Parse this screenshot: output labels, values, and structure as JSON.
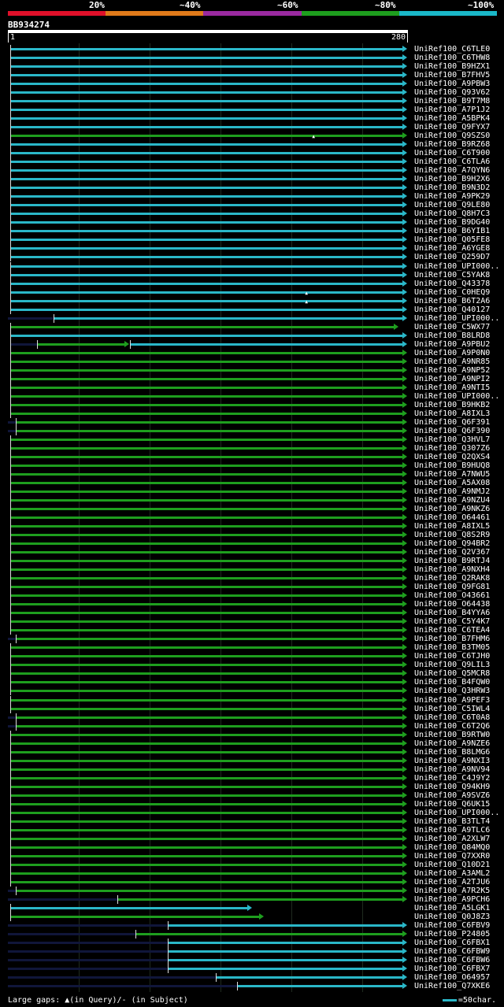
{
  "header": {
    "pct_labels": [
      "20%",
      "~40%",
      "~60%",
      "~80%",
      "~100%"
    ],
    "colors": [
      "#e0102a",
      "#e07a1a",
      "#9a2aa0",
      "#1e9e1e",
      "#1ab8c8"
    ]
  },
  "query": {
    "id": "BB934274",
    "start": "1",
    "end": "280"
  },
  "colors": {
    "cyan": "#2ab7c8",
    "green": "#1e9e1e",
    "purple": "#9a2aa0",
    "orange": "#e07a1a",
    "red": "#e0102a",
    "navy": "#10163a"
  },
  "hits": [
    {
      "label": "UniRef100_C6TLE0",
      "s": 1,
      "e": 280,
      "c": "cyan",
      "a": 1
    },
    {
      "label": "UniRef100_C6THW8",
      "s": 1,
      "e": 280,
      "c": "cyan",
      "a": 1
    },
    {
      "label": "UniRef100_B9HZX1",
      "s": 1,
      "e": 280,
      "c": "cyan",
      "a": 1
    },
    {
      "label": "UniRef100_B7FHV5",
      "s": 1,
      "e": 280,
      "c": "cyan",
      "a": 1
    },
    {
      "label": "UniRef100_A9PBW3",
      "s": 1,
      "e": 280,
      "c": "cyan",
      "a": 1
    },
    {
      "label": "UniRef100_Q93V62",
      "s": 1,
      "e": 280,
      "c": "cyan",
      "a": 1
    },
    {
      "label": "UniRef100_B9T7M8",
      "s": 1,
      "e": 280,
      "c": "cyan",
      "a": 1
    },
    {
      "label": "UniRef100_A7P1J2",
      "s": 1,
      "e": 280,
      "c": "cyan",
      "a": 1
    },
    {
      "label": "UniRef100_A5BPK4",
      "s": 1,
      "e": 280,
      "c": "cyan",
      "a": 1
    },
    {
      "label": "UniRef100_Q9FYX7",
      "s": 1,
      "e": 280,
      "c": "cyan",
      "a": 1
    },
    {
      "label": "UniRef100_Q9SZS0",
      "s": 1,
      "e": 280,
      "c": "green",
      "a": 1,
      "g": 217
    },
    {
      "label": "UniRef100_B9RZ68",
      "s": 1,
      "e": 280,
      "c": "cyan",
      "a": 1
    },
    {
      "label": "UniRef100_C6T900",
      "s": 1,
      "e": 280,
      "c": "cyan",
      "a": 1
    },
    {
      "label": "UniRef100_C6TLA6",
      "s": 1,
      "e": 280,
      "c": "cyan",
      "a": 1
    },
    {
      "label": "UniRef100_A7QYN6",
      "s": 1,
      "e": 280,
      "c": "cyan",
      "a": 1
    },
    {
      "label": "UniRef100_B9H2X6",
      "s": 1,
      "e": 280,
      "c": "cyan",
      "a": 1
    },
    {
      "label": "UniRef100_B9N3D2",
      "s": 1,
      "e": 280,
      "c": "cyan",
      "a": 1
    },
    {
      "label": "UniRef100_A9PK29",
      "s": 1,
      "e": 280,
      "c": "cyan",
      "a": 1
    },
    {
      "label": "UniRef100_Q9LE80",
      "s": 1,
      "e": 280,
      "c": "cyan",
      "a": 1
    },
    {
      "label": "UniRef100_Q8H7C3",
      "s": 1,
      "e": 280,
      "c": "cyan",
      "a": 1
    },
    {
      "label": "UniRef100_B9DG40",
      "s": 1,
      "e": 280,
      "c": "cyan",
      "a": 1
    },
    {
      "label": "UniRef100_B6YIB1",
      "s": 1,
      "e": 280,
      "c": "cyan",
      "a": 1
    },
    {
      "label": "UniRef100_Q05FE8",
      "s": 1,
      "e": 280,
      "c": "cyan",
      "a": 1
    },
    {
      "label": "UniRef100_A6YGE8",
      "s": 1,
      "e": 280,
      "c": "cyan",
      "a": 1
    },
    {
      "label": "UniRef100_Q259D7",
      "s": 1,
      "e": 280,
      "c": "cyan",
      "a": 1
    },
    {
      "label": "UniRef100_UPI000..",
      "s": 1,
      "e": 280,
      "c": "cyan",
      "a": 1
    },
    {
      "label": "UniRef100_C5YAK8",
      "s": 1,
      "e": 280,
      "c": "cyan",
      "a": 1
    },
    {
      "label": "UniRef100_Q43378",
      "s": 1,
      "e": 280,
      "c": "cyan",
      "a": 1
    },
    {
      "label": "UniRef100_C0HEQ9",
      "s": 1,
      "e": 280,
      "c": "cyan",
      "a": 1,
      "g": 212
    },
    {
      "label": "UniRef100_B6T2A6",
      "s": 1,
      "e": 280,
      "c": "cyan",
      "a": 1,
      "g": 212
    },
    {
      "label": "UniRef100_Q40127",
      "s": 1,
      "e": 280,
      "c": "cyan",
      "a": 1
    },
    {
      "label": "UniRef100_UPI000..",
      "s": 32,
      "e": 280,
      "c": "cyan",
      "a": 1,
      "t": 1
    },
    {
      "label": "UniRef100_C5WX77",
      "s": 1,
      "e": 274,
      "c": "green",
      "a": 1
    },
    {
      "label": "UniRef100_B8LRD8",
      "s": 1,
      "e": 280,
      "c": "cyan",
      "a": 1
    },
    {
      "label": "UniRef100_A9PBU2",
      "s": 1,
      "e": 280,
      "c": "mixed",
      "a": 1
    },
    {
      "label": "UniRef100_A9P0N0",
      "s": 1,
      "e": 280,
      "c": "green",
      "a": 1
    },
    {
      "label": "UniRef100_A9NR85",
      "s": 1,
      "e": 280,
      "c": "green",
      "a": 1
    },
    {
      "label": "UniRef100_A9NP52",
      "s": 1,
      "e": 280,
      "c": "green",
      "a": 1
    },
    {
      "label": "UniRef100_A9NPI2",
      "s": 1,
      "e": 280,
      "c": "green",
      "a": 1
    },
    {
      "label": "UniRef100_A9NTI5",
      "s": 1,
      "e": 280,
      "c": "green",
      "a": 1
    },
    {
      "label": "UniRef100_UPI000..",
      "s": 1,
      "e": 280,
      "c": "green",
      "a": 1
    },
    {
      "label": "UniRef100_B9HKB2",
      "s": 1,
      "e": 280,
      "c": "green",
      "a": 1
    },
    {
      "label": "UniRef100_A8IXL3",
      "s": 1,
      "e": 280,
      "c": "green",
      "a": 1
    },
    {
      "label": "UniRef100_Q6F391",
      "s": 5,
      "e": 280,
      "c": "green",
      "a": 1,
      "t": 1
    },
    {
      "label": "UniRef100_Q6F390",
      "s": 5,
      "e": 280,
      "c": "green",
      "a": 1,
      "t": 1
    },
    {
      "label": "UniRef100_Q3HVL7",
      "s": 1,
      "e": 280,
      "c": "green",
      "a": 1
    },
    {
      "label": "UniRef100_Q307Z6",
      "s": 1,
      "e": 280,
      "c": "green",
      "a": 1
    },
    {
      "label": "UniRef100_Q2QXS4",
      "s": 1,
      "e": 280,
      "c": "green",
      "a": 1
    },
    {
      "label": "UniRef100_B9HUQ8",
      "s": 1,
      "e": 280,
      "c": "green",
      "a": 1
    },
    {
      "label": "UniRef100_A7NWU5",
      "s": 1,
      "e": 280,
      "c": "green",
      "a": 1
    },
    {
      "label": "UniRef100_A5AX08",
      "s": 1,
      "e": 280,
      "c": "green",
      "a": 1
    },
    {
      "label": "UniRef100_A9NMJ2",
      "s": 1,
      "e": 280,
      "c": "green",
      "a": 1
    },
    {
      "label": "UniRef100_A9NZU4",
      "s": 1,
      "e": 280,
      "c": "green",
      "a": 1
    },
    {
      "label": "UniRef100_A9NKZ6",
      "s": 1,
      "e": 280,
      "c": "green",
      "a": 1
    },
    {
      "label": "UniRef100_O64461",
      "s": 1,
      "e": 280,
      "c": "green",
      "a": 1
    },
    {
      "label": "UniRef100_A8IXL5",
      "s": 1,
      "e": 280,
      "c": "green",
      "a": 1
    },
    {
      "label": "UniRef100_Q8S2R9",
      "s": 1,
      "e": 280,
      "c": "green",
      "a": 1
    },
    {
      "label": "UniRef100_Q94BR2",
      "s": 1,
      "e": 280,
      "c": "green",
      "a": 1
    },
    {
      "label": "UniRef100_Q2V367",
      "s": 1,
      "e": 280,
      "c": "green",
      "a": 1
    },
    {
      "label": "UniRef100_B9RTJ4",
      "s": 1,
      "e": 280,
      "c": "green",
      "a": 1
    },
    {
      "label": "UniRef100_A9NXH4",
      "s": 1,
      "e": 280,
      "c": "green",
      "a": 1
    },
    {
      "label": "UniRef100_Q2RAK8",
      "s": 1,
      "e": 280,
      "c": "green",
      "a": 1
    },
    {
      "label": "UniRef100_Q9FG81",
      "s": 1,
      "e": 280,
      "c": "green",
      "a": 1
    },
    {
      "label": "UniRef100_O43661",
      "s": 1,
      "e": 280,
      "c": "green",
      "a": 1
    },
    {
      "label": "UniRef100_O64438",
      "s": 1,
      "e": 280,
      "c": "green",
      "a": 1
    },
    {
      "label": "UniRef100_B4YYA6",
      "s": 1,
      "e": 280,
      "c": "green",
      "a": 1
    },
    {
      "label": "UniRef100_C5Y4K7",
      "s": 1,
      "e": 280,
      "c": "green",
      "a": 1
    },
    {
      "label": "UniRef100_C6TEA4",
      "s": 1,
      "e": 280,
      "c": "green",
      "a": 1
    },
    {
      "label": "UniRef100_B7FHM6",
      "s": 5,
      "e": 280,
      "c": "green",
      "a": 1,
      "t": 1
    },
    {
      "label": "UniRef100_B3TM05",
      "s": 1,
      "e": 280,
      "c": "green",
      "a": 1
    },
    {
      "label": "UniRef100_C6TJH0",
      "s": 1,
      "e": 280,
      "c": "green",
      "a": 1
    },
    {
      "label": "UniRef100_Q9LIL3",
      "s": 1,
      "e": 280,
      "c": "green",
      "a": 1
    },
    {
      "label": "UniRef100_Q5MCR8",
      "s": 1,
      "e": 280,
      "c": "green",
      "a": 1
    },
    {
      "label": "UniRef100_B4FQW0",
      "s": 1,
      "e": 280,
      "c": "green",
      "a": 1
    },
    {
      "label": "UniRef100_Q3HRW3",
      "s": 1,
      "e": 280,
      "c": "green",
      "a": 1
    },
    {
      "label": "UniRef100_A9PEF3",
      "s": 1,
      "e": 280,
      "c": "green",
      "a": 1
    },
    {
      "label": "UniRef100_C5IWL4",
      "s": 1,
      "e": 280,
      "c": "green",
      "a": 1
    },
    {
      "label": "UniRef100_C6T0A8",
      "s": 5,
      "e": 280,
      "c": "green",
      "a": 1,
      "t": 1
    },
    {
      "label": "UniRef100_C6T2Q6",
      "s": 5,
      "e": 280,
      "c": "green",
      "a": 1,
      "t": 1
    },
    {
      "label": "UniRef100_B9RTW0",
      "s": 1,
      "e": 280,
      "c": "green",
      "a": 1
    },
    {
      "label": "UniRef100_A9NZE6",
      "s": 1,
      "e": 280,
      "c": "green",
      "a": 1
    },
    {
      "label": "UniRef100_B8LMG6",
      "s": 1,
      "e": 280,
      "c": "green",
      "a": 1
    },
    {
      "label": "UniRef100_A9NXI3",
      "s": 1,
      "e": 280,
      "c": "green",
      "a": 1
    },
    {
      "label": "UniRef100_A9NV94",
      "s": 1,
      "e": 280,
      "c": "green",
      "a": 1
    },
    {
      "label": "UniRef100_C4J9Y2",
      "s": 1,
      "e": 280,
      "c": "green",
      "a": 1
    },
    {
      "label": "UniRef100_Q94KH9",
      "s": 1,
      "e": 280,
      "c": "green",
      "a": 1
    },
    {
      "label": "UniRef100_A9SVZ6",
      "s": 1,
      "e": 280,
      "c": "green",
      "a": 1
    },
    {
      "label": "UniRef100_Q6UK15",
      "s": 1,
      "e": 280,
      "c": "green",
      "a": 1
    },
    {
      "label": "UniRef100_UPI000..",
      "s": 1,
      "e": 280,
      "c": "green",
      "a": 1
    },
    {
      "label": "UniRef100_B3TLT4",
      "s": 1,
      "e": 280,
      "c": "green",
      "a": 1
    },
    {
      "label": "UniRef100_A9TLC6",
      "s": 1,
      "e": 280,
      "c": "green",
      "a": 1
    },
    {
      "label": "UniRef100_A2XLW7",
      "s": 1,
      "e": 280,
      "c": "green",
      "a": 1
    },
    {
      "label": "UniRef100_Q84MQ0",
      "s": 1,
      "e": 280,
      "c": "green",
      "a": 1
    },
    {
      "label": "UniRef100_Q7XXR0",
      "s": 1,
      "e": 280,
      "c": "green",
      "a": 1
    },
    {
      "label": "UniRef100_Q10D21",
      "s": 1,
      "e": 280,
      "c": "green",
      "a": 1
    },
    {
      "label": "UniRef100_A3AML2",
      "s": 1,
      "e": 280,
      "c": "green",
      "a": 1
    },
    {
      "label": "UniRef100_A2TJU6",
      "s": 1,
      "e": 280,
      "c": "green",
      "a": 1
    },
    {
      "label": "UniRef100_A7R2K5",
      "s": 5,
      "e": 280,
      "c": "green",
      "a": 1,
      "t": 1
    },
    {
      "label": "UniRef100_A9PCH6",
      "s": 77,
      "e": 280,
      "c": "green",
      "a": 1,
      "t": 1
    },
    {
      "label": "UniRef100_A5LGK1",
      "s": 1,
      "e": 170,
      "c": "cyan",
      "a": 1
    },
    {
      "label": "UniRef100_Q0J8Z3",
      "s": 1,
      "e": 178,
      "c": "green",
      "a": 1
    },
    {
      "label": "UniRef100_C6FBV9",
      "s": 113,
      "e": 280,
      "c": "cyan",
      "a": 1,
      "t": 1
    },
    {
      "label": "UniRef100_P24805",
      "s": 90,
      "e": 280,
      "c": "green",
      "a": 1,
      "t": 1
    },
    {
      "label": "UniRef100_C6FBX1",
      "s": 113,
      "e": 280,
      "c": "cyan",
      "a": 1,
      "t": 1
    },
    {
      "label": "UniRef100_C6FBW9",
      "s": 113,
      "e": 280,
      "c": "cyan",
      "a": 1,
      "t": 1
    },
    {
      "label": "UniRef100_C6FBW6",
      "s": 113,
      "e": 280,
      "c": "cyan",
      "a": 1,
      "t": 1
    },
    {
      "label": "UniRef100_C6FBX7",
      "s": 113,
      "e": 280,
      "c": "cyan",
      "a": 1,
      "t": 1
    },
    {
      "label": "UniRef100_O64957",
      "s": 147,
      "e": 280,
      "c": "cyan",
      "a": 1,
      "t": 1
    },
    {
      "label": "UniRef100_Q7XKE6",
      "s": 162,
      "e": 280,
      "c": "cyan",
      "a": 1,
      "t": 1
    }
  ],
  "footer": {
    "gaps_label": "Large gaps:",
    "gaps_query_glyph": "▲",
    "gaps_query_text": "(in Query)/",
    "gaps_subject_text": "- (in Subject)",
    "scale_text": "=50char."
  }
}
